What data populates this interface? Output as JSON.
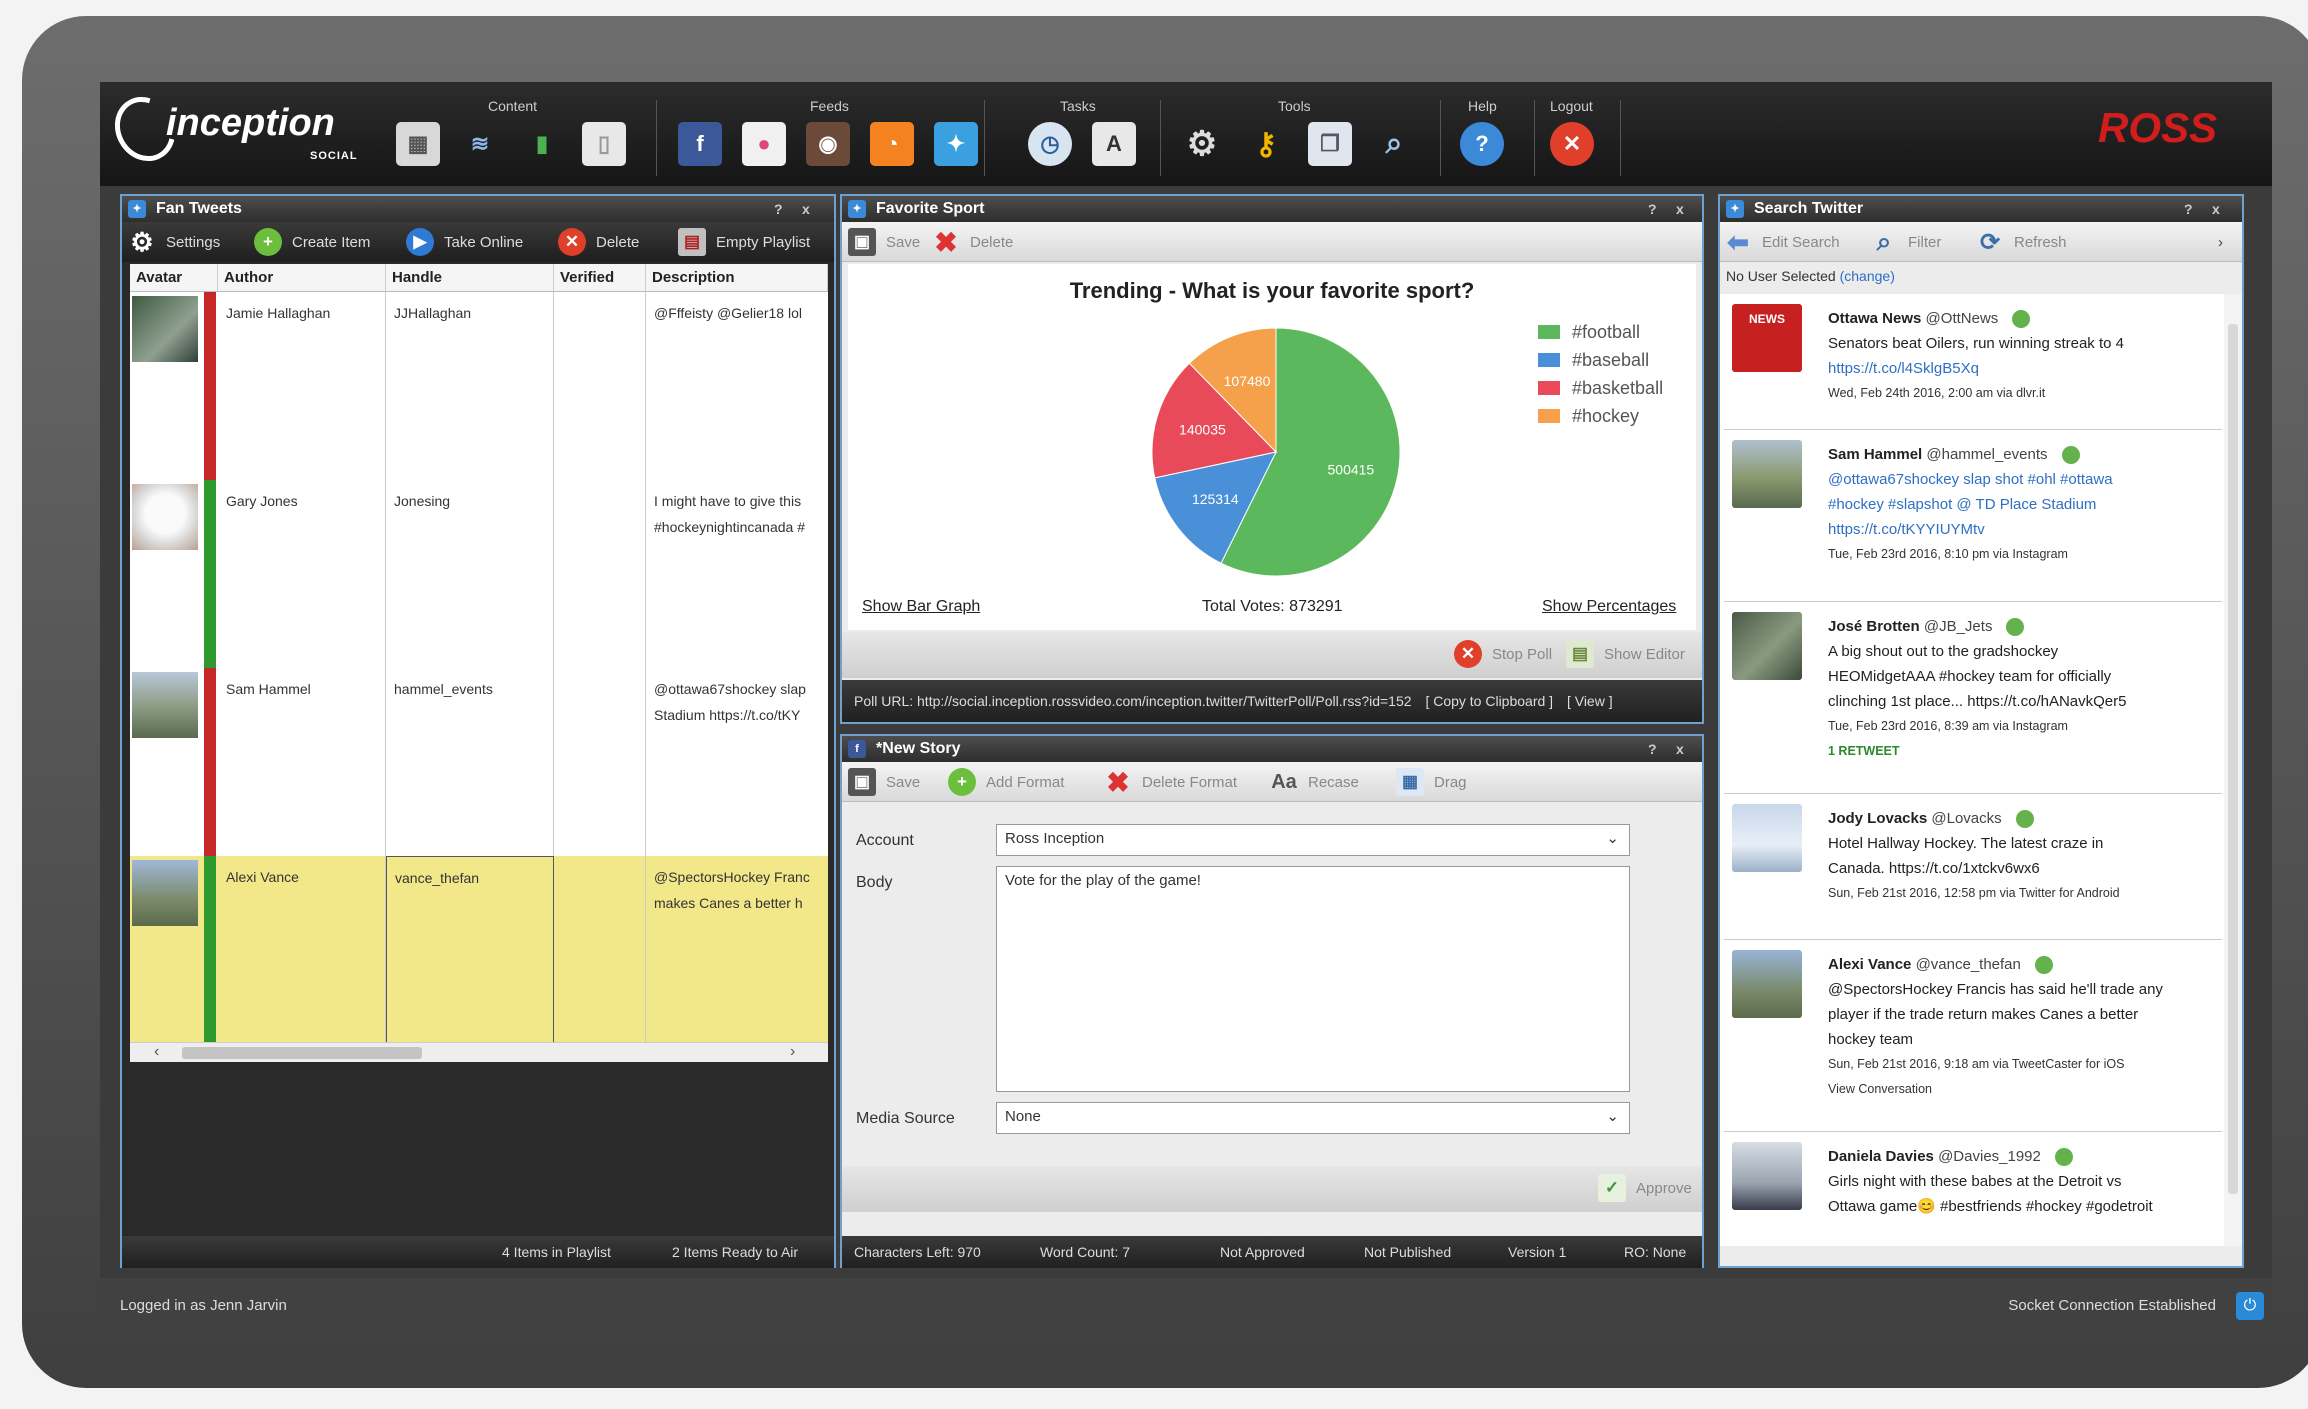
{
  "app": {
    "logo": "inception",
    "logo_sub": "SOCIAL",
    "brand": "ROSS"
  },
  "toolbar": {
    "groups": [
      "Content",
      "Feeds",
      "Tasks",
      "Tools",
      "Help",
      "Logout"
    ]
  },
  "fan_tweets": {
    "title": "Fan Tweets",
    "actions": [
      "Settings",
      "Create Item",
      "Take Online",
      "Delete",
      "Empty Playlist"
    ],
    "columns": [
      "Avatar",
      "Author",
      "Handle",
      "Verified",
      "Description"
    ],
    "rows": [
      {
        "author": "Jamie Hallaghan",
        "handle": "JJHallaghan",
        "desc1": "@Fffeisty @Gelier18 lol",
        "desc2": "",
        "status_color": "#c62828"
      },
      {
        "author": "Gary Jones",
        "handle": "Jonesing",
        "desc1": "I might have to give this",
        "desc2": "#hockeynightincanada #",
        "status_color": "#2e9a2e"
      },
      {
        "author": "Sam Hammel",
        "handle": "hammel_events",
        "desc1": "@ottawa67shockey slap",
        "desc2": "Stadium https://t.co/tKY",
        "status_color": "#c62828"
      },
      {
        "author": "Alexi Vance",
        "handle": "vance_thefan",
        "desc1": "@SpectorsHockey Franc",
        "desc2": "makes Canes a better h",
        "status_color": "#2e9a2e"
      }
    ],
    "footer": {
      "items_in_playlist": "4 Items in Playlist",
      "ready_to_air": "2 Items Ready to Air"
    }
  },
  "favorite_sport": {
    "title": "Favorite Sport",
    "actions": [
      "Save",
      "Delete"
    ],
    "show_bar_graph": "Show Bar Graph",
    "total_votes": "Total Votes: 873291",
    "show_percentages": "Show Percentages",
    "stop_poll": "Stop Poll",
    "show_editor": "Show Editor",
    "poll_url": "Poll URL: http://social.inception.rossvideo.com/inception.twitter/TwitterPoll/Poll.rss?id=152",
    "copy": "[ Copy to Clipboard ]",
    "view": "[ View ]"
  },
  "chart_data": {
    "type": "pie",
    "title": "Trending - What is your favorite sport?",
    "categories": [
      "#football",
      "#baseball",
      "#basketball",
      "#hockey"
    ],
    "values": [
      500415,
      125314,
      140035,
      107480
    ],
    "colors": [
      "#5cb85c",
      "#4a90d9",
      "#e84a5a",
      "#f5a04a"
    ],
    "legend": "right"
  },
  "new_story": {
    "title": "*New Story",
    "actions": [
      "Save",
      "Add Format",
      "Delete Format",
      "Recase",
      "Drag"
    ],
    "account_label": "Account",
    "account_value": "Ross Inception",
    "body_label": "Body",
    "body_value": "Vote for the play of the game!",
    "media_label": "Media Source",
    "media_value": "None",
    "approve": "Approve",
    "status": [
      "Characters Left: 970",
      "Word Count: 7",
      "Not Approved",
      "Not Published",
      "Version 1",
      "RO: None"
    ]
  },
  "search_twitter": {
    "title": "Search Twitter",
    "actions": [
      "Edit Search",
      "Filter",
      "Refresh"
    ],
    "user_label": "No User Selected",
    "change": "(change)",
    "tweets": [
      {
        "name": "Ottawa News",
        "handle": "@OttNews",
        "line1": "Senators beat Oilers, run winning streak to 4",
        "link": "https://t.co/l4SklgB5Xq",
        "line3": "",
        "meta": "Wed, Feb 24th 2016, 2:00 am via dlvr.it",
        "extra": ""
      },
      {
        "name": "Sam Hammel",
        "handle": "@hammel_events",
        "line1": "@ottawa67shockey slap shot #ohl #ottawa",
        "link": "#hockey #slapshot @ TD Place Stadium",
        "line3": "https://t.co/tKYYIUYMtv",
        "meta": "Tue, Feb 23rd 2016, 8:10 pm via Instagram",
        "extra": ""
      },
      {
        "name": "José Brotten",
        "handle": "@JB_Jets",
        "line1": "A big shout out to the gradshockey",
        "link": "HEOMidgetAAA #hockey team for officially",
        "line3": "clinching 1st place... https://t.co/hANavkQer5",
        "meta": "Tue, Feb 23rd 2016, 8:39 am via Instagram",
        "extra": "1 RETWEET"
      },
      {
        "name": "Jody Lovacks",
        "handle": "@Lovacks",
        "line1": "Hotel Hallway Hockey. The latest craze in",
        "link": "Canada. https://t.co/1xtckv6wx6",
        "line3": "",
        "meta": "Sun, Feb 21st 2016, 12:58 pm via Twitter for Android",
        "extra": ""
      },
      {
        "name": "Alexi Vance",
        "handle": "@vance_thefan",
        "line1": "@SpectorsHockey Francis has said he'll trade any",
        "link": "player if the trade return makes Canes a better",
        "line3": "hockey team",
        "meta": "Sun, Feb 21st 2016, 9:18 am via TweetCaster for iOS",
        "extra": "View Conversation"
      },
      {
        "name": "Daniela Davies",
        "handle": "@Davies_1992",
        "line1": "Girls night with these babes at the Detroit vs",
        "link": "Ottawa game😊 #bestfriends #hockey #godetroit",
        "line3": "",
        "meta": "",
        "extra": ""
      }
    ]
  },
  "statusbar": {
    "left": "Logged in as Jenn Jarvin",
    "right": "Socket Connection Established"
  }
}
